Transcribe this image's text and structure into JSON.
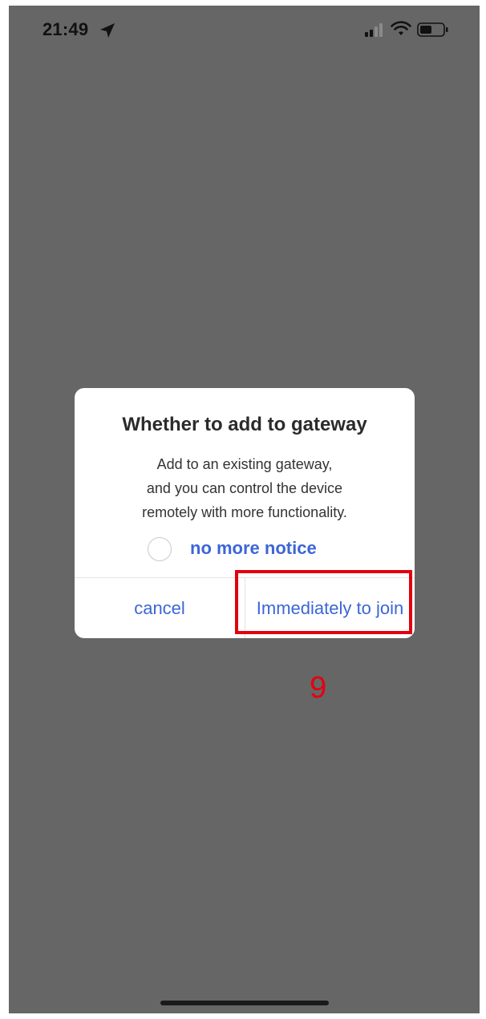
{
  "status_bar": {
    "time": "21:49",
    "icons": [
      "location-arrow-icon",
      "cellular-signal-icon",
      "wifi-icon",
      "battery-icon"
    ]
  },
  "dialog": {
    "title": "Whether to add to gateway",
    "message_lines": [
      "Add to an existing gateway,",
      "and you can control the device",
      "remotely with more functionality."
    ],
    "notice_label": "no more notice",
    "notice_checked": false,
    "cancel_label": "cancel",
    "join_label": "Immediately to join"
  },
  "annotation": {
    "step_number": "9",
    "color": "#e3000f"
  },
  "colors": {
    "overlay": "#666666",
    "accent": "#3c66d6"
  }
}
